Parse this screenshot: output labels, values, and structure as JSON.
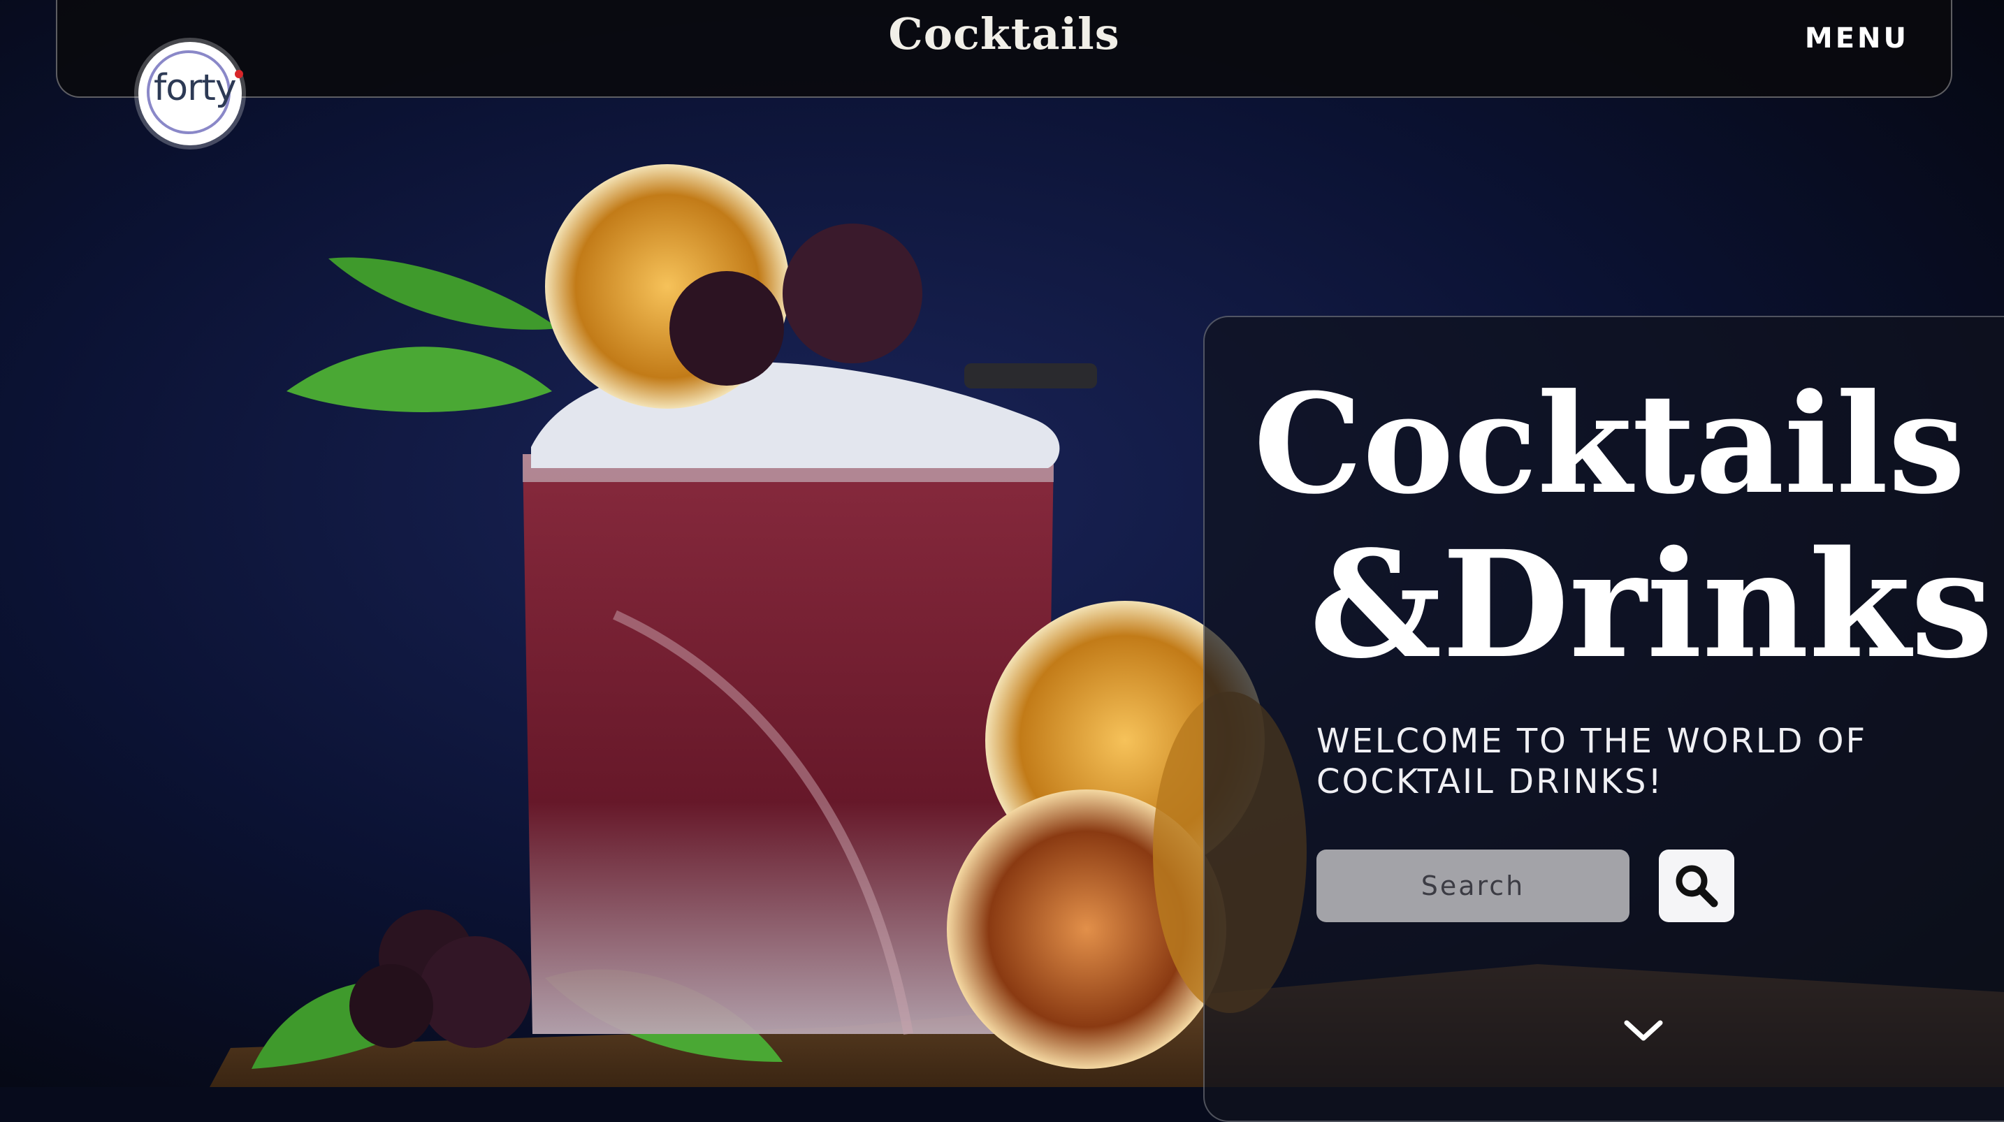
{
  "header": {
    "title": "Cocktails",
    "menu_label": "MENU",
    "logo_text": "forty"
  },
  "hero": {
    "title_line1": "Cocktails",
    "title_line2": "&Drinks",
    "subtitle": "WELCOME TO THE WORLD OF COCKTAIL DRINKS!"
  },
  "search": {
    "placeholder": "Search"
  },
  "icons": {
    "search": "magnifier-icon",
    "scroll": "chevron-down-icon"
  },
  "colors": {
    "background": "#070b1c",
    "drink": "#7a1d2c",
    "panel": "#10121e",
    "text": "#ffffff"
  }
}
